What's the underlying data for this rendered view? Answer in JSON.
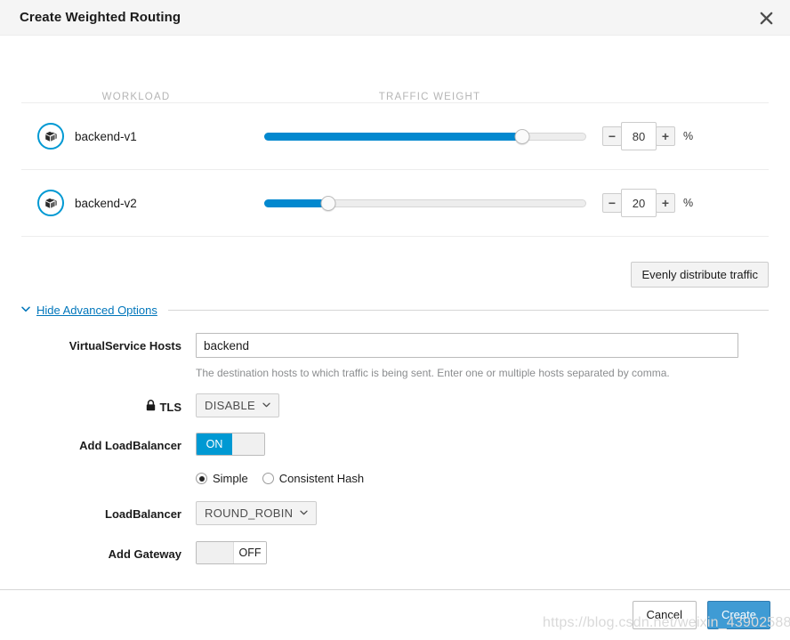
{
  "dialog": {
    "title": "Create Weighted Routing",
    "close_icon": "close-icon"
  },
  "table": {
    "headers": {
      "workload": "WORKLOAD",
      "traffic_weight": "TRAFFIC WEIGHT"
    },
    "rows": [
      {
        "name": "backend-v1",
        "weight": "80",
        "weight_pct": 80,
        "unit": "%",
        "minus": "−",
        "plus": "+"
      },
      {
        "name": "backend-v2",
        "weight": "20",
        "weight_pct": 20,
        "unit": "%",
        "minus": "−",
        "plus": "+"
      }
    ]
  },
  "evenly_button": {
    "label": "Evenly distribute traffic"
  },
  "advanced": {
    "chevron": "∨",
    "link_label": "Hide Advanced Options"
  },
  "form": {
    "hosts": {
      "label": "VirtualService Hosts",
      "value": "backend",
      "placeholder": "",
      "help": "The destination hosts to which traffic is being sent. Enter one or multiple hosts separated by comma."
    },
    "tls": {
      "label": "TLS",
      "lock_icon": "lock-icon",
      "value": "DISABLE",
      "caret": "∨"
    },
    "loadbalancer_toggle": {
      "label": "Add LoadBalancer",
      "state": "ON"
    },
    "lb_mode": {
      "options": [
        {
          "label": "Simple",
          "selected": true
        },
        {
          "label": "Consistent Hash",
          "selected": false
        }
      ]
    },
    "loadbalancer": {
      "label": "LoadBalancer",
      "value": "ROUND_ROBIN",
      "caret": "∨"
    },
    "gateway_toggle": {
      "label": "Add Gateway",
      "state": "OFF"
    }
  },
  "footer": {
    "cancel": "Cancel",
    "create": "Create"
  },
  "watermark": {
    "text": "https://blog.csdn.net/weixin_43902588"
  },
  "colors": {
    "accent": "#0099d3",
    "slider_fill": "#0288cf",
    "link": "#0076bb",
    "primary_button": "#3f9bd4",
    "header_bg": "#f5f5f5",
    "muted_text": "#b5b5b5"
  }
}
